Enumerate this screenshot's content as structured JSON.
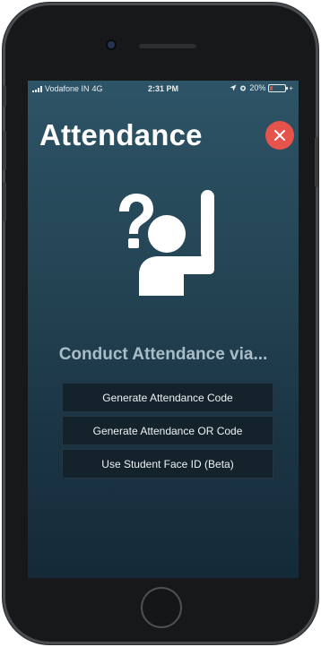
{
  "status_bar": {
    "carrier": "Vodafone IN",
    "network": "4G",
    "time": "2:31 PM",
    "battery_percent_label": "20%",
    "battery_level": 0.2,
    "battery_color": "#e24a3b",
    "charging_glyph": "+"
  },
  "header": {
    "title": "Attendance",
    "close_icon": "close-icon",
    "close_color": "#e5534b"
  },
  "hero": {
    "icon": "raised-hand-question-icon"
  },
  "main": {
    "subtitle": "Conduct Attendance via...",
    "options": [
      {
        "label": "Generate Attendance Code"
      },
      {
        "label": "Generate Attendance OR Code"
      },
      {
        "label": "Use Student Face ID (Beta)"
      }
    ]
  },
  "colors": {
    "background_top": "#2d5467",
    "background_bottom": "#152a38",
    "button_bg": "#13222b",
    "subtitle": "#a9bdc7"
  }
}
